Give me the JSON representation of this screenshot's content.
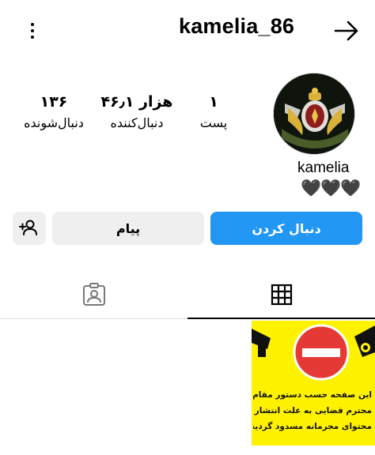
{
  "header": {
    "username": "kamelia_86",
    "menu_icon": "more-vertical-icon",
    "back_icon": "arrow-right-icon"
  },
  "profile": {
    "display_name": "kamelia",
    "bio": "🖤🖤🖤",
    "stats": {
      "posts": {
        "value": "۱",
        "label": "پست"
      },
      "followers": {
        "value": "۴۶٫۱ هزار",
        "label": "دنبال‌کننده"
      },
      "following": {
        "value": "۱۳۶",
        "label": "دنبال‌شونده"
      }
    }
  },
  "actions": {
    "follow_label": "دنبال کردن",
    "message_label": "پیام",
    "suggest_icon": "add-person-icon"
  },
  "tabs": [
    {
      "name": "tagged",
      "icon": "tagged-person-icon",
      "active": false
    },
    {
      "name": "grid",
      "icon": "grid-icon",
      "active": true
    }
  ],
  "posts": [
    {
      "lines": [
        "این صفحه حسب دستور مقام",
        "محترم قضایی به علت انتشار",
        "محتوای مجرمانه مسدود گردید."
      ]
    }
  ],
  "colors": {
    "accent": "#2196f3",
    "secondary_button": "#efefef",
    "notice_yellow": "#fff200",
    "stop_red": "#e53935"
  }
}
